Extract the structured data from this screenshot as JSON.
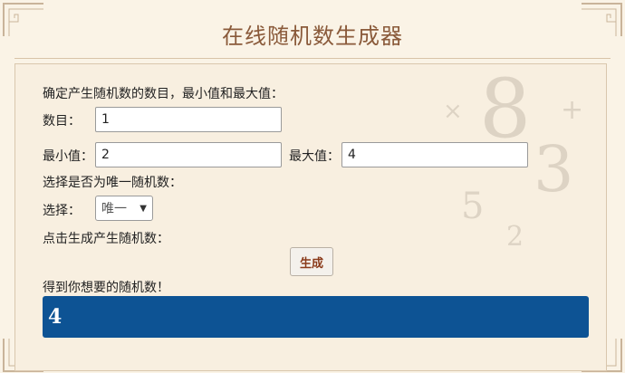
{
  "title": "在线随机数生成器",
  "instructions": "确定产生随机数的数目，最小值和最大值：",
  "count": {
    "label": "数目：",
    "value": "1"
  },
  "min": {
    "label": "最小值：",
    "value": "2"
  },
  "max": {
    "label": "最大值：",
    "value": "4"
  },
  "unique_prompt": "选择是否为唯一随机数：",
  "choice": {
    "label": "选择：",
    "selected": "唯一"
  },
  "generate_prompt": "点击生成产生随机数：",
  "generate_button": "生成",
  "result_prompt": "得到你想要的随机数！",
  "result_value": "4",
  "colors": {
    "title": "#8a5a3a",
    "result_bg": "#0d5394",
    "button_text": "#8a3a1a",
    "page_bg": "#faf3e6"
  }
}
